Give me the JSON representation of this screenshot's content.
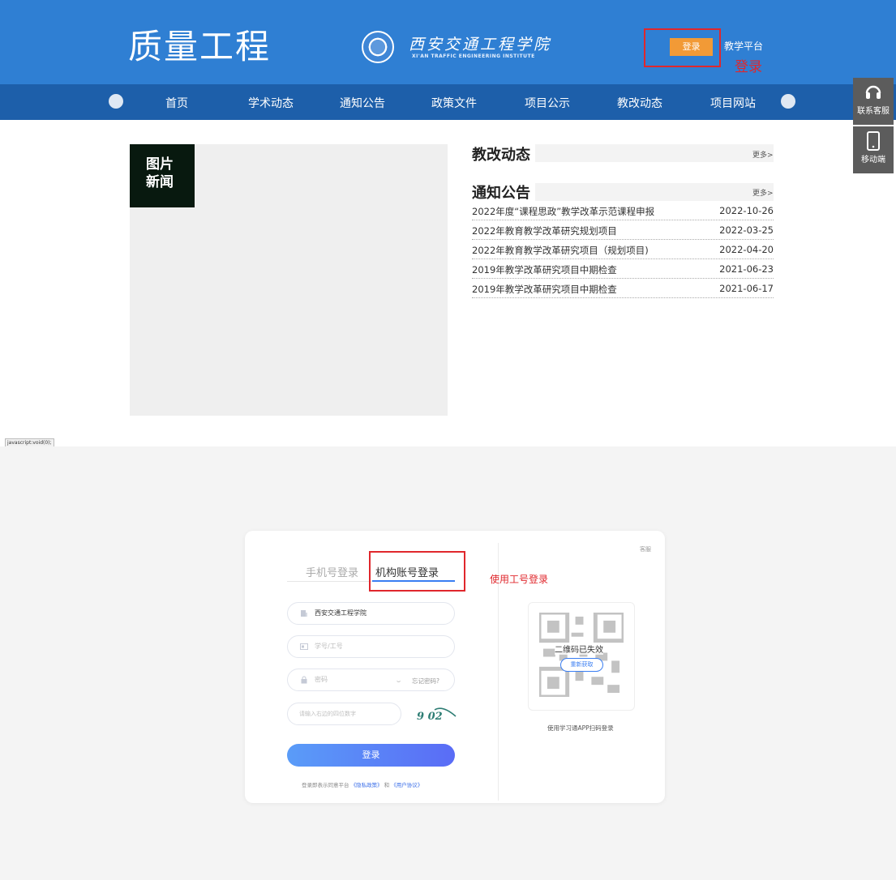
{
  "header": {
    "site_title": "质量工程",
    "school_name_cn": "西安交通工程学院",
    "school_name_en": "XI'AN TRAFFIC ENGINEERING INSTITUTE",
    "login_button": "登录",
    "platform_link": "教学平台",
    "login_annotation": "登录"
  },
  "nav": {
    "items": [
      "首页",
      "学术动态",
      "通知公告",
      "政策文件",
      "项目公示",
      "教改动态",
      "项目网站"
    ]
  },
  "side_widgets": {
    "service": "联系客服",
    "mobile": "移动端"
  },
  "photo_news": {
    "label_line1": "图片",
    "label_line2": "新闻"
  },
  "reform": {
    "title": "教改动态",
    "more": "更多>"
  },
  "notices": {
    "title": "通知公告",
    "more": "更多>",
    "items": [
      {
        "title": "2022年度“课程思政”教学改革示范课程申报",
        "date": "2022-10-26"
      },
      {
        "title": "2022年教育教学改革研究规划项目",
        "date": "2022-03-25"
      },
      {
        "title": "2022年教育教学改革研究项目（规划项目)",
        "date": "2022-04-20"
      },
      {
        "title": "2019年教学改革研究项目中期检查",
        "date": "2021-06-23"
      },
      {
        "title": "2019年教学改革研究项目中期检查",
        "date": "2021-06-17"
      }
    ]
  },
  "status_tip": "javascript:void(0);",
  "login": {
    "tab_phone": "手机号登录",
    "tab_org": "机构账号登录",
    "annotation": "使用工号登录",
    "school_value": "西安交通工程学院",
    "id_placeholder": "学号/工号",
    "password_placeholder": "密码",
    "forgot": "忘记密码?",
    "captcha_placeholder": "请输入右边的四位数字",
    "captcha_text": "9 02",
    "submit": "登录",
    "agreement_prefix": "登录即表示同意平台",
    "privacy": "《隐私政策》",
    "and": "和",
    "terms": "《用户协议》",
    "service": "客服",
    "qr_expired": "二维码已失效",
    "qr_refresh": "重新获取",
    "qr_caption": "使用学习通APP扫码登录"
  },
  "colors": {
    "header_blue": "#2f7fd3",
    "nav_blue": "#1d5faa",
    "login_orange": "#f29a36",
    "annotation_red": "#e0272c",
    "accent_blue": "#3a7ef2"
  }
}
